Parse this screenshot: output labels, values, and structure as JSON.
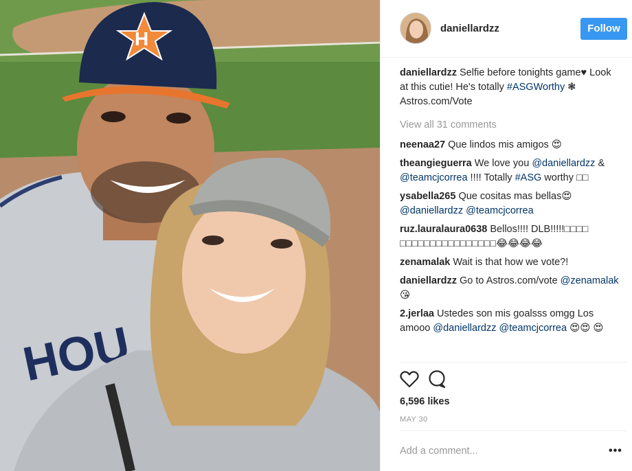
{
  "post": {
    "username": "daniellardzz",
    "follow_label": "Follow",
    "caption_user": "daniellardzz",
    "caption_text_1": "Selfie before tonights game♥ Look at this cutie! He's totally ",
    "caption_tag": "#ASGWorthy",
    "caption_text_2": " ❃ Astros.com/Vote",
    "view_all": "View all 31 comments",
    "likes": "6,596 likes",
    "date": "MAY 30",
    "add_comment_placeholder": "Add a comment...",
    "more_label": "•••"
  },
  "comments": [
    {
      "user": "neenaa27",
      "text": "Que lindos mis amigos 😍"
    },
    {
      "user": "theangieguerra",
      "text_1": "We love you ",
      "tag_1": "@daniellardzz",
      "text_2": " & ",
      "tag_2": "@teamcjcorrea",
      "text_3": " !!!! Totally ",
      "tag_3": "#ASG",
      "text_4": " worthy □□"
    },
    {
      "user": "ysabella265",
      "text_1": "Que cositas mas bellas😍 ",
      "tag_1": "@daniellardzz",
      "text_2": " ",
      "tag_2": "@teamcjcorrea"
    },
    {
      "user": "ruz.lauralaura0638",
      "text": "Bellos!!!! DLB!!!!!□□□□ □□□□□□□□□□□□□□□□😂😂😂😂"
    },
    {
      "user": "zenamalak",
      "text": "Wait is that how we vote?!"
    },
    {
      "user": "daniellardzz",
      "text_1": "Go to Astros.com/vote ",
      "tag_1": "@zenamalak",
      "text_2": " 😘"
    },
    {
      "user": "2.jerlaa",
      "text_1": "Ustedes son mis goalsss omgg Los amooo ",
      "tag_1": "@daniellardzz",
      "text_2": " ",
      "tag_2": "@teamcjcorrea",
      "text_3": " 😍😍 😍"
    }
  ],
  "icons": {
    "like": "heart-icon",
    "comment": "comment-icon"
  },
  "colors": {
    "follow_bg": "#3897f0",
    "tag": "#003569",
    "muted": "#999999"
  }
}
